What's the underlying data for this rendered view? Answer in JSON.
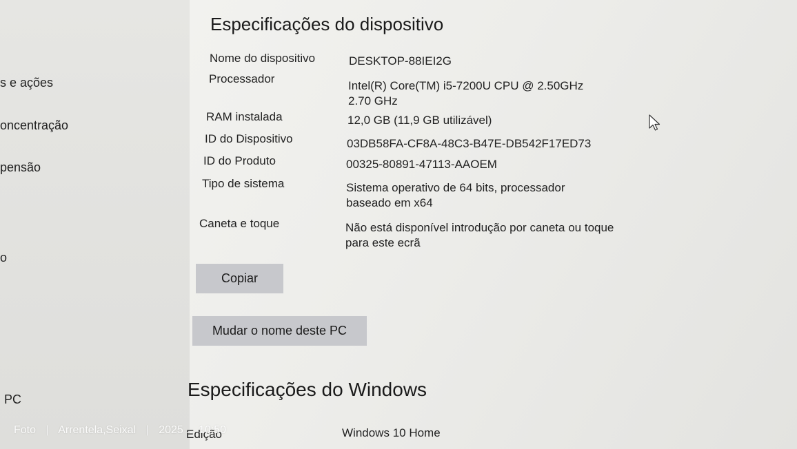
{
  "sidebar": {
    "items": [
      {
        "label": "s e ações"
      },
      {
        "label": "oncentração"
      },
      {
        "label": "pensão"
      },
      {
        "label": "o"
      },
      {
        "label": "PC"
      }
    ]
  },
  "device_specs": {
    "title": "Especificações do dispositivo",
    "rows": [
      {
        "label": "Nome do dispositivo",
        "value": "DESKTOP-88IEI2G"
      },
      {
        "label": "Processador",
        "value": "Intel(R) Core(TM) i5-7200U CPU @ 2.50GHz 2.70 GHz"
      },
      {
        "label": "RAM instalada",
        "value": "12,0 GB (11,9 GB utilizável)"
      },
      {
        "label": "ID do Dispositivo",
        "value": "03DB58FA-CF8A-48C3-B47E-DB542F17ED73"
      },
      {
        "label": "ID do Produto",
        "value": "00325-80891-47113-AAOEM"
      },
      {
        "label": "Tipo de sistema",
        "value": "Sistema operativo de 64 bits, processador baseado em x64"
      },
      {
        "label": "Caneta e toque",
        "value": "Não está disponível introdução por caneta ou toque para este ecrã"
      }
    ],
    "copy_button": "Copiar",
    "rename_button": "Mudar o nome deste PC"
  },
  "windows_specs": {
    "title": "Especificações do Windows",
    "rows": [
      {
        "label": "Edição",
        "value": "Windows 10 Home"
      }
    ]
  },
  "watermark": {
    "app": "Foto",
    "location": "Arrentela,Seixal",
    "datetime": "2025 ... 10:50"
  }
}
